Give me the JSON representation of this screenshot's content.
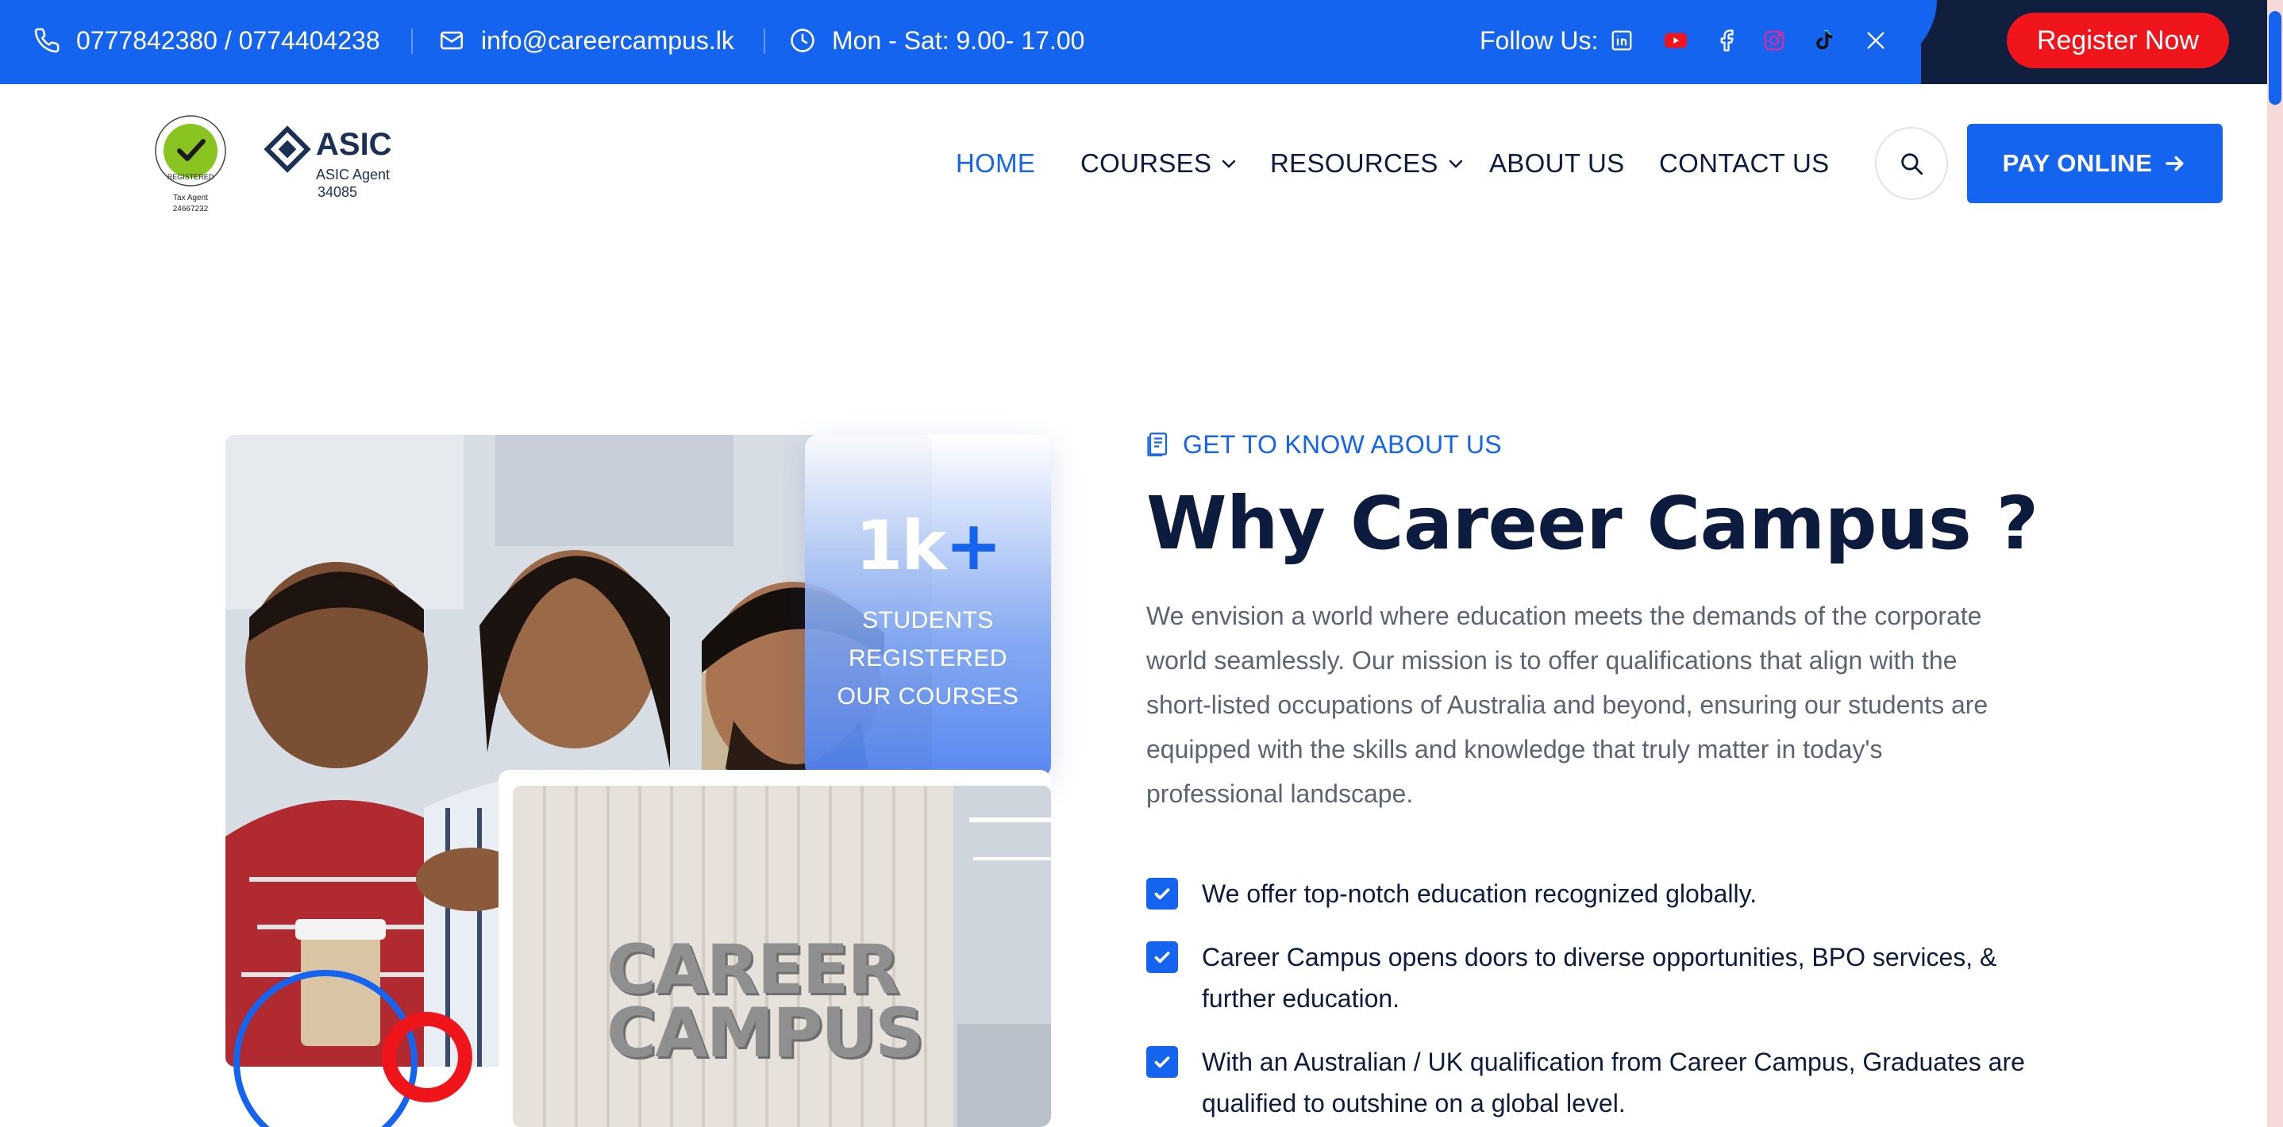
{
  "topbar": {
    "phone": "0777842380 / 0774404238",
    "email": "info@careercampus.lk",
    "hours": "Mon - Sat: 9.00- 17.00",
    "follow_label": "Follow Us:",
    "register_label": "Register Now"
  },
  "logos": {
    "tpb_ring_text": "TAX PRACTITIONERS BOARD",
    "tpb_center": "REGISTERED",
    "tpb_caption_1": "Tax Agent",
    "tpb_caption_2": "24667232",
    "asic_name": "ASIC",
    "asic_caption_1": "ASIC Agent",
    "asic_caption_2": "34085"
  },
  "nav": {
    "items": [
      {
        "label": "HOME",
        "active": true
      },
      {
        "label": "COURSES",
        "dropdown": true
      },
      {
        "label": "RESOURCES",
        "dropdown": true
      },
      {
        "label": "ABOUT US"
      },
      {
        "label": "CONTACT US"
      }
    ],
    "pay_label": "PAY ONLINE"
  },
  "stat": {
    "number": "1k",
    "plus": "+",
    "line1": "STUDENTS",
    "line2": "REGISTERED",
    "line3": "OUR COURSES"
  },
  "signage": {
    "line1": "CAREER",
    "line2": "CAMPUS"
  },
  "about": {
    "eyebrow": "GET TO KNOW ABOUT US",
    "title": "Why Career Campus ?",
    "paragraph": "We envision a world where education meets the demands of the corporate world seamlessly. Our mission is to offer qualifications that align with the short-listed occupations of Australia and beyond, ensuring our students are equipped with the skills and knowledge that truly matter in today's professional landscape.",
    "checks": [
      "We offer top-notch education recognized globally.",
      "Career Campus opens doors to diverse opportunities, BPO services, & further education.",
      "With an Australian / UK qualification from Career Campus, Graduates are qualified to outshine on a global level."
    ]
  },
  "colors": {
    "brand_blue": "#1464f0",
    "navy": "#0d1b3e",
    "register_red": "#f0151a"
  }
}
